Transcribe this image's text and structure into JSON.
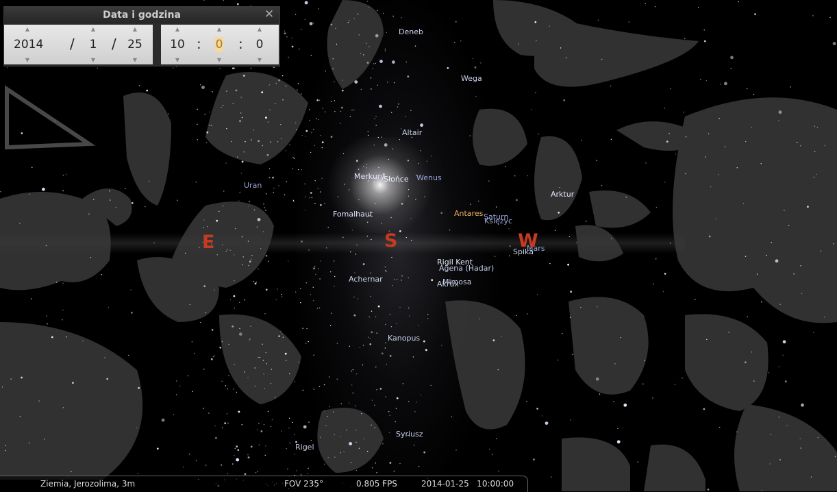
{
  "dialog": {
    "title": "Data i godzina",
    "year": "2014",
    "month": "1",
    "day": "25",
    "hour": "10",
    "minute": "0",
    "second": "0",
    "date_sep": "/",
    "time_sep": ":",
    "up_arrow": "▲",
    "down_arrow": "▼",
    "close_glyph": "✕"
  },
  "cardinals": {
    "east": "E",
    "south": "S",
    "west": "W"
  },
  "labels": {
    "deneb": "Deneb",
    "wega": "Wega",
    "altair": "Altair",
    "merkury": "Merkury",
    "slonce": "Słońce",
    "wenus": "Wenus",
    "uran": "Uran",
    "fomalhaut": "Fomalhaut",
    "antares": "Antares",
    "saturn": "Saturn",
    "ksiezyc": "Księżyc",
    "arktur": "Arktur",
    "mars": "Mars",
    "spika": "Spika",
    "rigil_kent": "Rigil Kent",
    "agena": "Agena (Hadar)",
    "mimosa": "Mimosa",
    "akrux": "Akrux",
    "achernar": "Achernar",
    "kanopus": "Kanopus",
    "syriusz": "Syriusz",
    "rigel": "Rigel"
  },
  "status": {
    "location": "Ziemia, Jerozolima, 3m",
    "fov": "FOV 235°",
    "fps": "0.805 FPS",
    "datetime": "2014-01-25   10:00:00"
  },
  "colors": {
    "cardinal": "#c63a22",
    "label": "#b8c4e0",
    "highlight": "#f4d9a0"
  }
}
